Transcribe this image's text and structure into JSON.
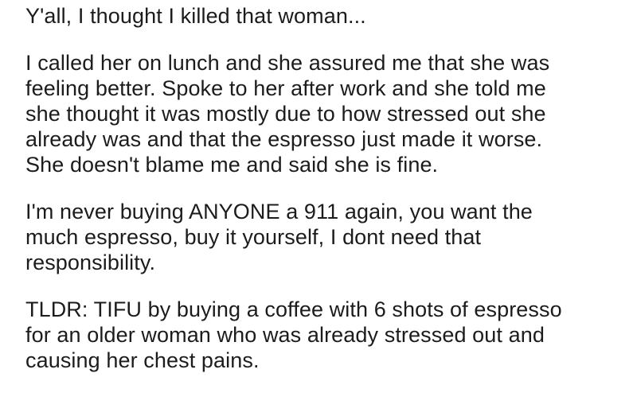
{
  "post": {
    "paragraphs": [
      {
        "lines": [
          "Y'all, I thought I killed that woman..."
        ]
      },
      {
        "lines": [
          "I called her on lunch and she assured me that she was",
          "feeling better. Spoke to her after work and she told me",
          "she thought it was mostly due to how stressed out she",
          "already was and that the espresso just made it worse.",
          "She doesn't blame me and said she is fine."
        ]
      },
      {
        "lines": [
          "I'm never buying ANYONE a 911 again, you want the",
          "much espresso, buy it yourself, I dont need that",
          "responsibility."
        ]
      },
      {
        "lines": [
          "TLDR: TIFU by buying a coffee with 6 shots of espresso",
          "for an older woman who was already stressed out and",
          "causing her chest pains."
        ]
      }
    ]
  }
}
